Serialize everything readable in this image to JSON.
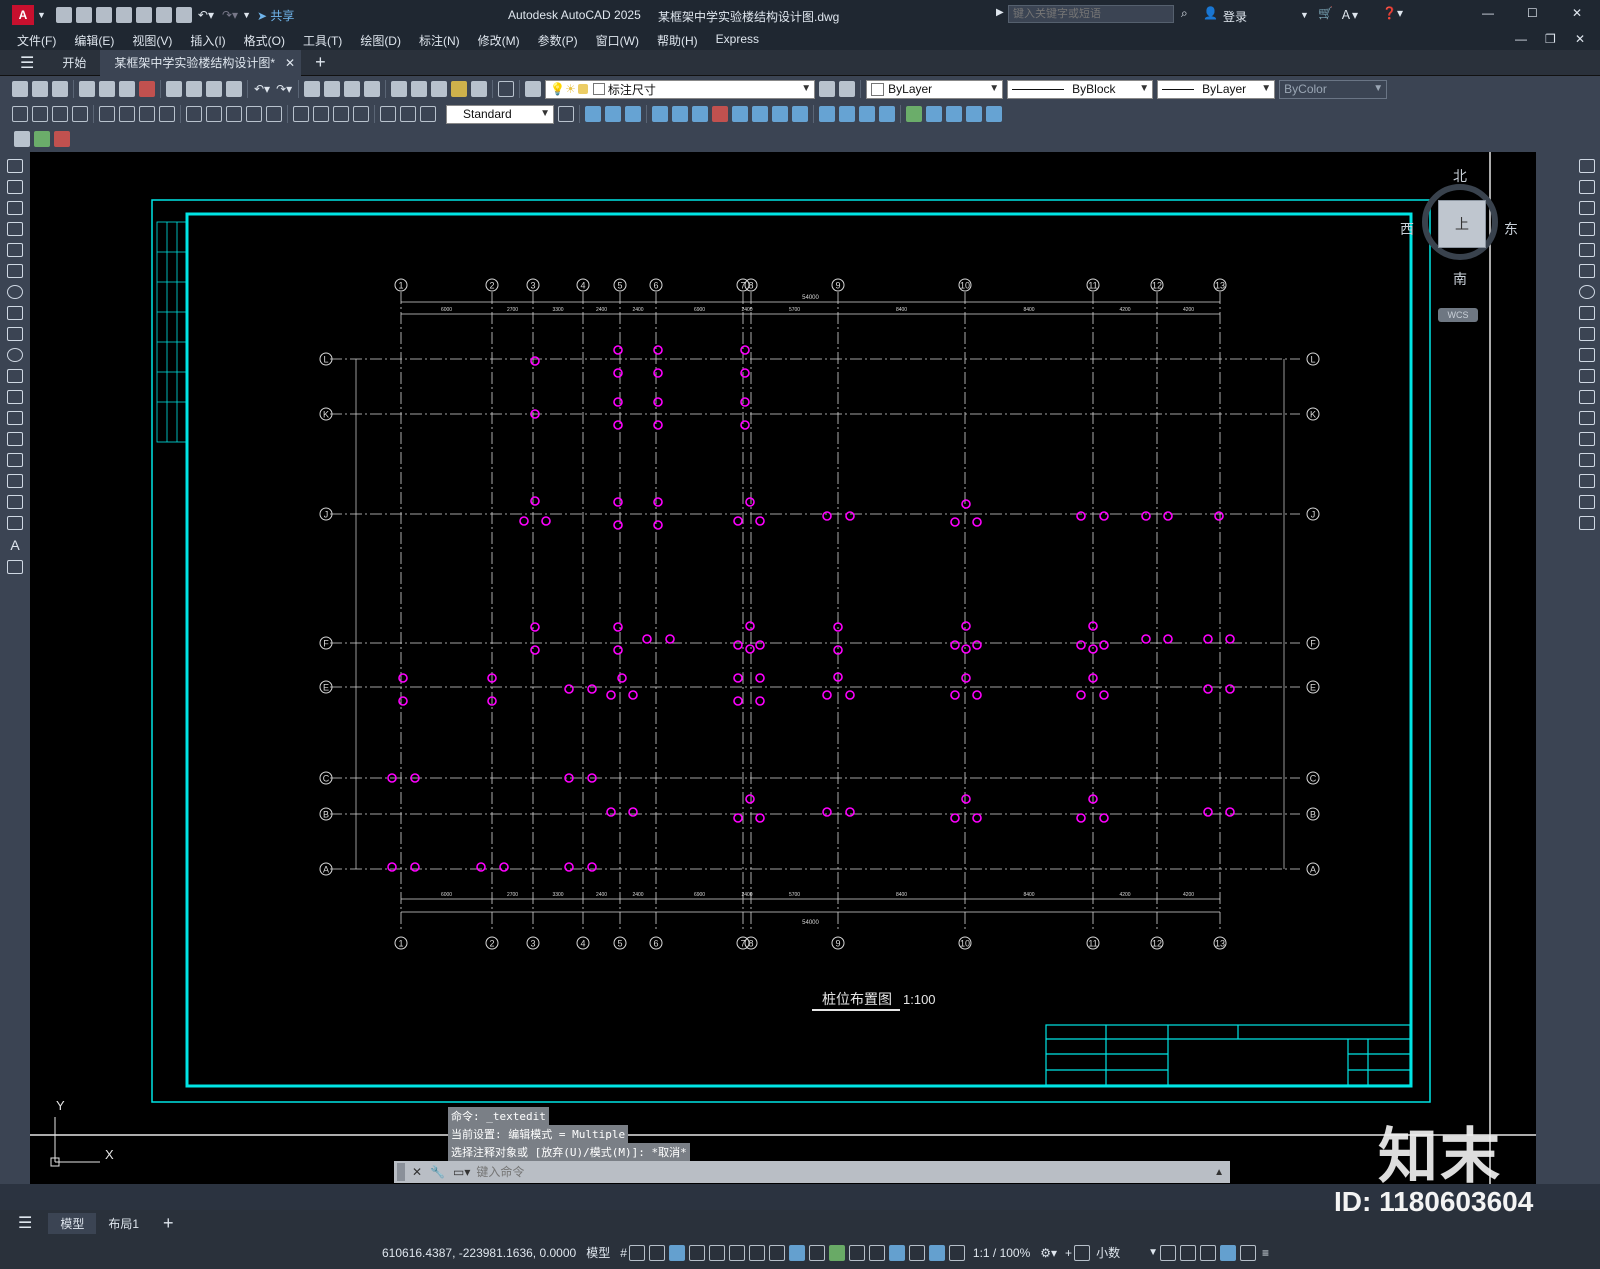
{
  "titlebar": {
    "app_title": "Autodesk AutoCAD 2025",
    "doc_title": "某框架中学实验楼结构设计图.dwg",
    "search_placeholder": "键入关键字或短语",
    "login": "登录",
    "share": "共享"
  },
  "menu": [
    "文件(F)",
    "编辑(E)",
    "视图(V)",
    "插入(I)",
    "格式(O)",
    "工具(T)",
    "绘图(D)",
    "标注(N)",
    "修改(M)",
    "参数(P)",
    "窗口(W)",
    "帮助(H)",
    "Express"
  ],
  "tabs": {
    "start": "开始",
    "doc": "某框架中学实验楼结构设计图*"
  },
  "toolbar": {
    "layer": "标注尺寸",
    "color": "ByLayer",
    "linetype": "ByBlock",
    "lineweight": "ByLayer",
    "plotstyle": "ByColor",
    "textstyle": "Standard"
  },
  "viewcube": {
    "north": "北",
    "south": "南",
    "east": "东",
    "west": "西",
    "top": "上",
    "wcs": "WCS"
  },
  "drawing": {
    "title": "桩位布置图",
    "scale": "1:100",
    "grid_top": [
      "1",
      "2",
      "3",
      "4",
      "5",
      "6",
      "7",
      "8",
      "9",
      "10",
      "11",
      "12",
      "13"
    ],
    "grid_side": [
      "L",
      "K",
      "J",
      "F",
      "E",
      "C",
      "B",
      "A"
    ],
    "dims_top": [
      "6000",
      "2700",
      "3300",
      "2400",
      "2400",
      "6900",
      "2400",
      "5700",
      "8400",
      "8400",
      "4200",
      "4200"
    ],
    "dim_total": "54000"
  },
  "command": {
    "history": [
      "命令: _textedit",
      "当前设置: 编辑模式 = Multiple",
      "选择注释对象或 [放弃(U)/模式(M)]: *取消*"
    ],
    "placeholder": "键入命令"
  },
  "layout_tabs": [
    "模型",
    "布局1"
  ],
  "status": {
    "coords": "610616.4387, -223981.1636, 0.0000",
    "space": "模型",
    "scale": "1:1 / 100%",
    "units": "小数"
  },
  "watermark": {
    "logo": "知末",
    "id": "ID: 1180603604"
  },
  "colors": {
    "accent": "#00e5e5",
    "pile": "#ff00ff",
    "canvas": "#000000",
    "ui_dark": "#1f2731"
  }
}
